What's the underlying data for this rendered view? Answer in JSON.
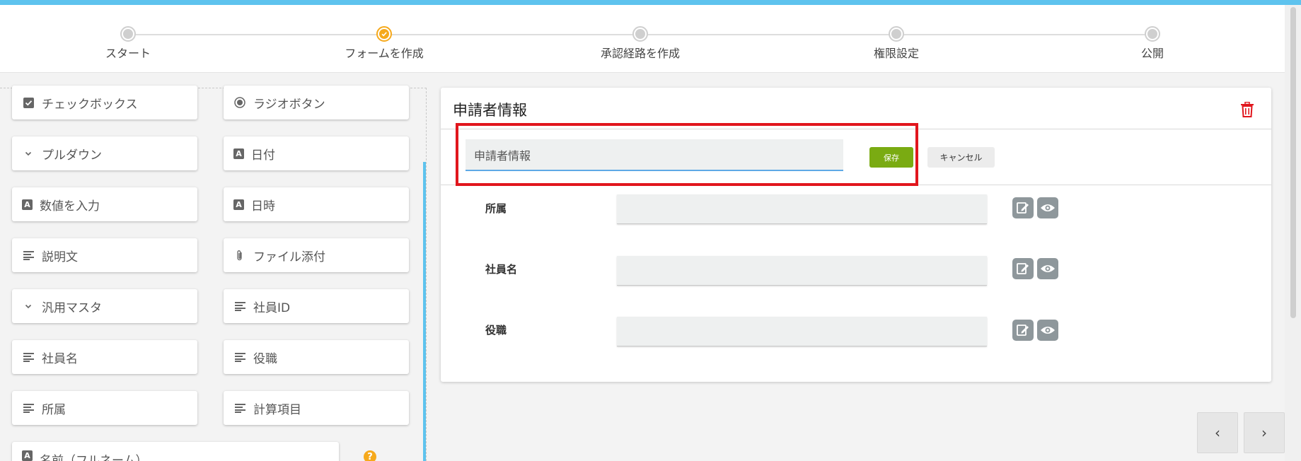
{
  "stepper": {
    "steps": [
      {
        "label": "スタート",
        "state": "inactive"
      },
      {
        "label": "フォームを作成",
        "state": "active"
      },
      {
        "label": "承認経路を作成",
        "state": "inactive"
      },
      {
        "label": "権限設定",
        "state": "inactive"
      },
      {
        "label": "公開",
        "state": "inactive"
      }
    ]
  },
  "palette": {
    "items": [
      {
        "label": "チェックボックス",
        "icon": "checkbox-icon"
      },
      {
        "label": "ラジオボタン",
        "icon": "radio-icon"
      },
      {
        "label": "プルダウン",
        "icon": "chevron-down-icon"
      },
      {
        "label": "日付",
        "icon": "text-field-icon"
      },
      {
        "label": "数値を入力",
        "icon": "text-field-icon"
      },
      {
        "label": "日時",
        "icon": "text-field-icon"
      },
      {
        "label": "説明文",
        "icon": "paragraph-icon"
      },
      {
        "label": "ファイル添付",
        "icon": "paperclip-icon"
      },
      {
        "label": "汎用マスタ",
        "icon": "chevron-down-icon"
      },
      {
        "label": "社員ID",
        "icon": "paragraph-icon"
      },
      {
        "label": "社員名",
        "icon": "paragraph-icon"
      },
      {
        "label": "役職",
        "icon": "paragraph-icon"
      },
      {
        "label": "所属",
        "icon": "paragraph-icon"
      },
      {
        "label": "計算項目",
        "icon": "paragraph-icon"
      },
      {
        "label": "名前（フルネーム）",
        "icon": "text-field-icon"
      }
    ]
  },
  "card": {
    "title": "申請者情報",
    "name_input_value": "申請者情報",
    "save_label": "保存",
    "cancel_label": "キャンセル",
    "fields": [
      {
        "label": "所属"
      },
      {
        "label": "社員名"
      },
      {
        "label": "役職"
      }
    ]
  },
  "pager": {
    "prev": "‹",
    "next": "›"
  },
  "colors": {
    "accent_blue": "#5ec3ee",
    "active_step": "#f6a91b",
    "save_green": "#7aab12",
    "highlight_red": "#e1161d",
    "trash_red": "#e1161d"
  }
}
